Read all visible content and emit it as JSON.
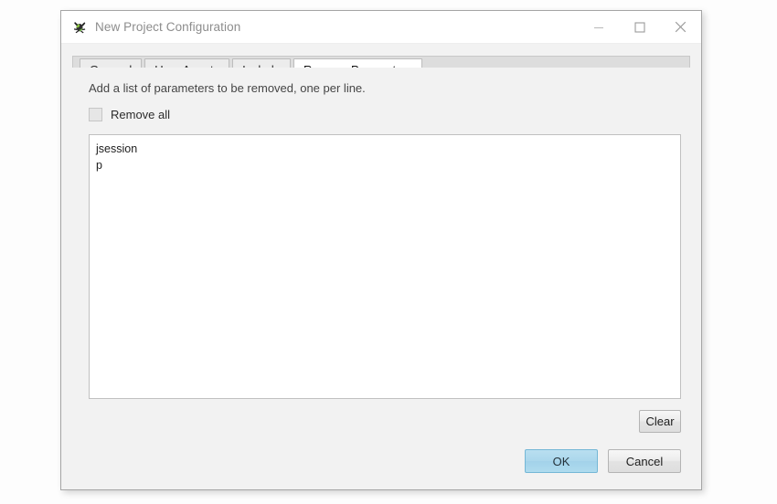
{
  "window": {
    "title": "New Project Configuration",
    "icon": "spider-crawler-icon",
    "controls": {
      "minimize": "minimize-icon",
      "maximize": "maximize-icon",
      "close": "close-icon"
    }
  },
  "tabs": [
    {
      "label": "General",
      "selected": false
    },
    {
      "label": "User Agents",
      "selected": false
    },
    {
      "label": "Include",
      "selected": false
    },
    {
      "label": "Remove Parameters",
      "selected": true
    }
  ],
  "panel": {
    "hint": "Add a list of parameters to be removed, one per line.",
    "checkbox": {
      "label": "Remove all",
      "checked": false
    },
    "textarea": {
      "value": "jsession\np",
      "lines": [
        "jsession",
        "p"
      ],
      "placeholder": ""
    },
    "clear_label": "Clear"
  },
  "footer": {
    "ok_label": "OK",
    "cancel_label": "Cancel"
  },
  "colors": {
    "accent_ok": "#a3d2ea",
    "accent_ok_border": "#74b7d6",
    "dialog_bg": "#f2f2f2",
    "titlebar_bg": "#ffffff",
    "tabstrip_bg": "#dddddd",
    "field_bg": "#ffffff",
    "page_bg": "#fdfdfd"
  }
}
